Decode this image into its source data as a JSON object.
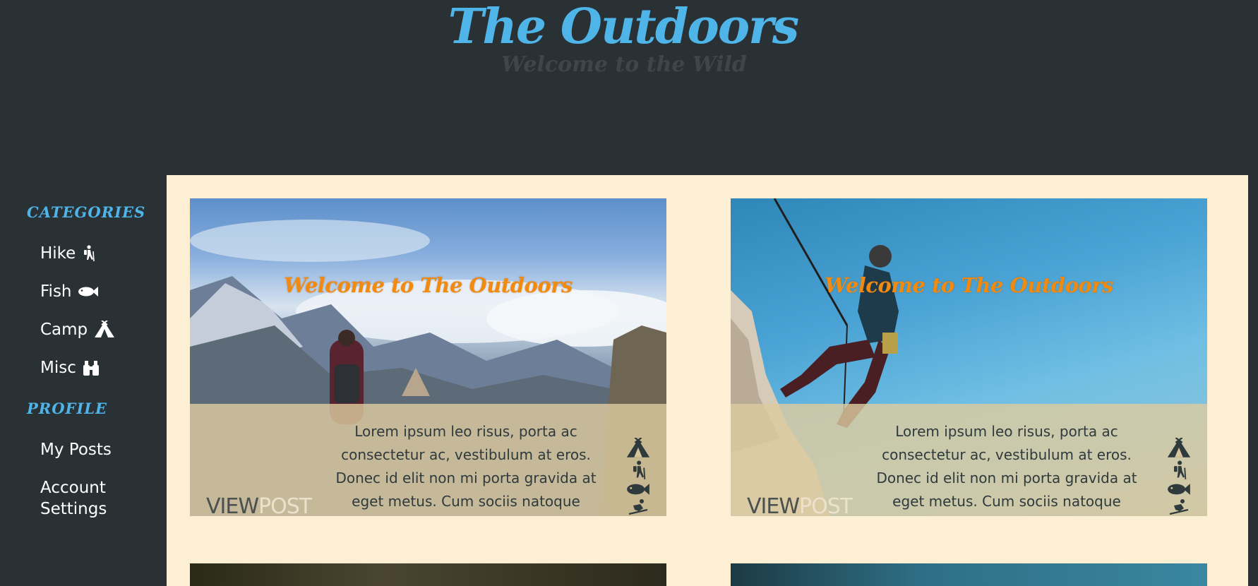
{
  "header": {
    "title": "The Outdoors",
    "tagline": "Welcome to the Wild"
  },
  "sidebar": {
    "categories_heading": "CATEGORIES",
    "categories": [
      {
        "label": "Hike",
        "icon": "hiker-icon"
      },
      {
        "label": "Fish",
        "icon": "fish-icon"
      },
      {
        "label": "Camp",
        "icon": "tent-icon"
      },
      {
        "label": "Misc",
        "icon": "binoculars-icon"
      }
    ],
    "profile_heading": "PROFILE",
    "profile_items": [
      {
        "label": "My Posts"
      },
      {
        "label": "Account Settings"
      }
    ]
  },
  "posts": [
    {
      "title": "Welcome to The Outdoors",
      "excerpt": "Lorem ipsum leo risus, porta ac consectetur ac, vestibulum at eros. Donec id elit non mi porta gravida at eget metus. Cum sociis natoque",
      "view_label": "VIEW",
      "post_label": "POST",
      "icons": [
        "tent-icon",
        "hiker-icon",
        "fish-icon",
        "skier-icon"
      ]
    },
    {
      "title": "Welcome to The Outdoors",
      "excerpt": "Lorem ipsum leo risus, porta ac consectetur ac, vestibulum at eros. Donec id elit non mi porta gravida at eget metus. Cum sociis natoque",
      "view_label": "VIEW",
      "post_label": "POST",
      "icons": [
        "tent-icon",
        "hiker-icon",
        "fish-icon",
        "skier-icon"
      ]
    }
  ],
  "colors": {
    "background": "#293134",
    "accent_blue": "#4fb4e8",
    "card_title_orange": "#f08a10",
    "content_panel": "#fcefd4"
  }
}
